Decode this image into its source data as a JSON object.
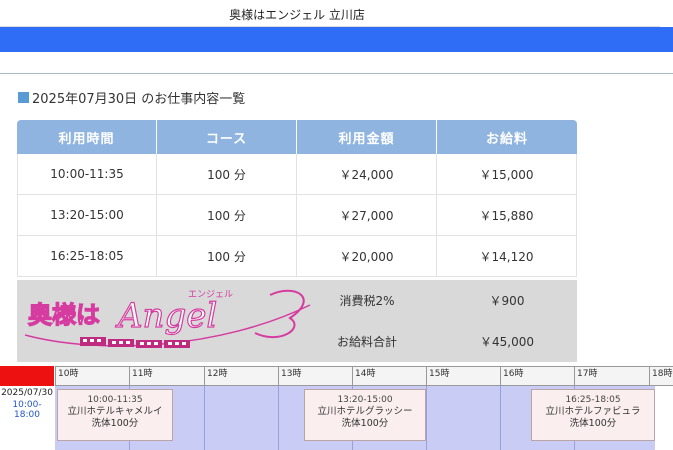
{
  "header": {
    "shop_name": "奥様はエンジェル 立川店"
  },
  "section": {
    "title": "2025年07月30日 のお仕事内容一覧"
  },
  "table": {
    "columns": [
      "利用時間",
      "コース",
      "利用金額",
      "お給料"
    ],
    "rows": [
      [
        "10:00-11:35",
        "100 分",
        "￥24,000",
        "￥15,000"
      ],
      [
        "13:20-15:00",
        "100 分",
        "￥27,000",
        "￥15,880"
      ],
      [
        "16:25-18:05",
        "100 分",
        "￥20,000",
        "￥14,120"
      ]
    ]
  },
  "summary": {
    "tax_label": "消費税2%",
    "tax_value": "￥900",
    "total_label": "お給料合計",
    "total_value": "￥45,000"
  },
  "logo": {
    "text_main": "奥様は",
    "text_script": "Angel",
    "text_kana": "エンジェル"
  },
  "timeline": {
    "date": "2025/07/30",
    "range": "10:00-18:00",
    "hours": [
      "10時",
      "11時",
      "12時",
      "13時",
      "14時",
      "15時",
      "16時",
      "17時",
      "18時"
    ],
    "bookings": [
      {
        "time": "10:00-11:35",
        "hotel": "立川ホテルキャメルイ",
        "course": "洗体100分"
      },
      {
        "time": "13:20-15:00",
        "hotel": "立川ホテルグラッシー",
        "course": "洗体100分"
      },
      {
        "time": "16:25-18:05",
        "hotel": "立川ホテルファビュラ",
        "course": "洗体100分"
      }
    ]
  },
  "colors": {
    "accent_bar": "#2f6df6",
    "table_header": "#8fb4e0",
    "timeline_bg": "#c9cdf5",
    "logo_pink": "#d63ca0"
  }
}
